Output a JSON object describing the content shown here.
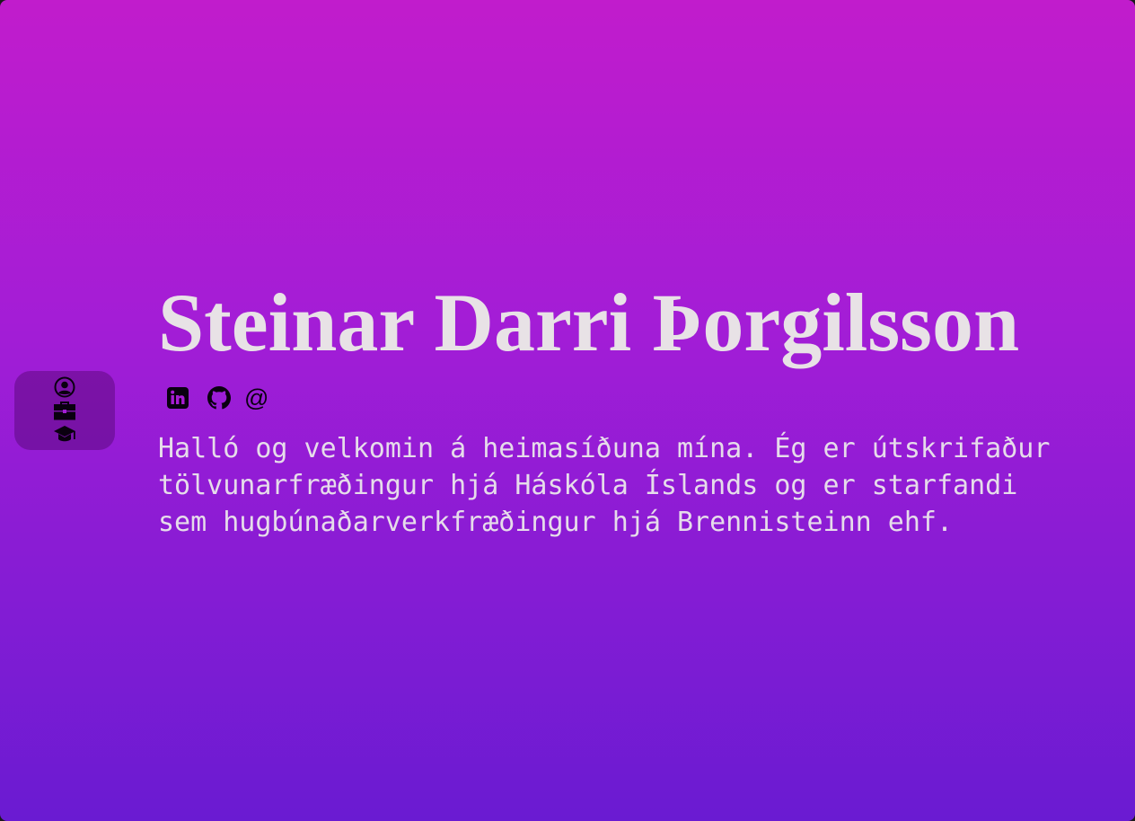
{
  "profile": {
    "name": "Steinar Darri Þorgilsson",
    "bio": "Halló og velkomin á heimasíðuna mína. Ég er útskrifaður tölvunarfræðingur hjá Háskóla Íslands og er starfandi sem hugbúnaðarverkfræðingur hjá Brennisteinn ehf."
  },
  "socials": {
    "linkedin_icon": "linkedin-icon",
    "github_icon": "github-icon",
    "email_symbol": "@"
  },
  "nav": {
    "items": [
      {
        "icon": "user-circle-icon"
      },
      {
        "icon": "briefcase-icon"
      },
      {
        "icon": "graduation-cap-icon"
      }
    ]
  },
  "colors": {
    "gradient_top": "#c11ccc",
    "gradient_bottom": "#6a1bd2",
    "text": "#e8e2e6",
    "icon": "#0a0010",
    "nav_bg": "rgba(60,0,80,0.35)"
  }
}
